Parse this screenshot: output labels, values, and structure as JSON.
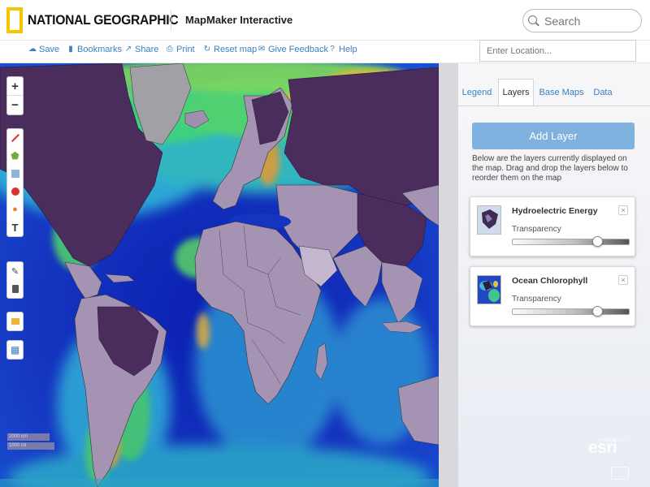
{
  "header": {
    "brand": "NATIONAL GEOGRAPHIC",
    "app_title": "MapMaker Interactive",
    "search_placeholder": "Search"
  },
  "toolbar": {
    "items": [
      {
        "label": "Save",
        "icon": "cloud-icon"
      },
      {
        "label": "Bookmarks",
        "icon": "bookmark-icon"
      },
      {
        "label": "Share",
        "icon": "share-icon"
      },
      {
        "label": "Print",
        "icon": "print-icon"
      },
      {
        "label": "Reset map",
        "icon": "refresh-icon"
      },
      {
        "label": "Give Feedback",
        "icon": "feedback-icon"
      },
      {
        "label": "Help",
        "icon": "help-icon"
      }
    ],
    "location_placeholder": "Enter Location..."
  },
  "map_controls": {
    "zoom_in": "+",
    "zoom_out": "−",
    "text_tool": "T",
    "scale_labels": [
      "2000 km",
      "1000 mi"
    ]
  },
  "panel": {
    "tabs": [
      "Legend",
      "Layers",
      "Base Maps",
      "Data"
    ],
    "active_tab": "Layers",
    "add_layer_label": "Add Layer",
    "description": "Below are the layers currently displayed on the map. Drag and drop the layers below to reorder them on the map",
    "layers": [
      {
        "name": "Hydroelectric Energy",
        "transparency_label": "Transparency",
        "transparency": 0.73
      },
      {
        "name": "Ocean Chlorophyll",
        "transparency_label": "Transparency",
        "transparency": 0.73
      }
    ],
    "close_symbol": "×"
  },
  "attribution": {
    "powered_by": "POWERED BY",
    "brand": "esri"
  },
  "colors": {
    "accent_blue": "#3a7fc1",
    "add_layer_button": "#7fb2de",
    "brand_yellow": "#f5c700",
    "ocean_deep": "#1531b8",
    "land_purple": "#4a2d5c",
    "land_gray": "#a593b4"
  }
}
